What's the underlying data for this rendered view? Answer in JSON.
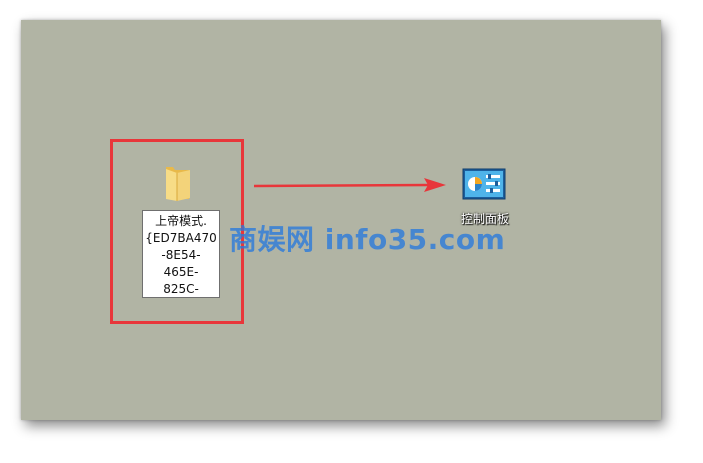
{
  "desktop": {
    "background_color": "#b1b4a4",
    "folder": {
      "icon": "folder-icon",
      "rename_lines": [
        "上帝模式.",
        "{ED7BA470",
        "-8E54-",
        "465E-",
        "825C-"
      ]
    },
    "control_panel": {
      "icon": "control-panel-icon",
      "label": "控制面板"
    },
    "annotation": {
      "box_color": "#e8363a",
      "arrow_color": "#e8363a"
    }
  },
  "watermark": {
    "text": "商娱网 info35.com",
    "color": "#2878dc"
  }
}
